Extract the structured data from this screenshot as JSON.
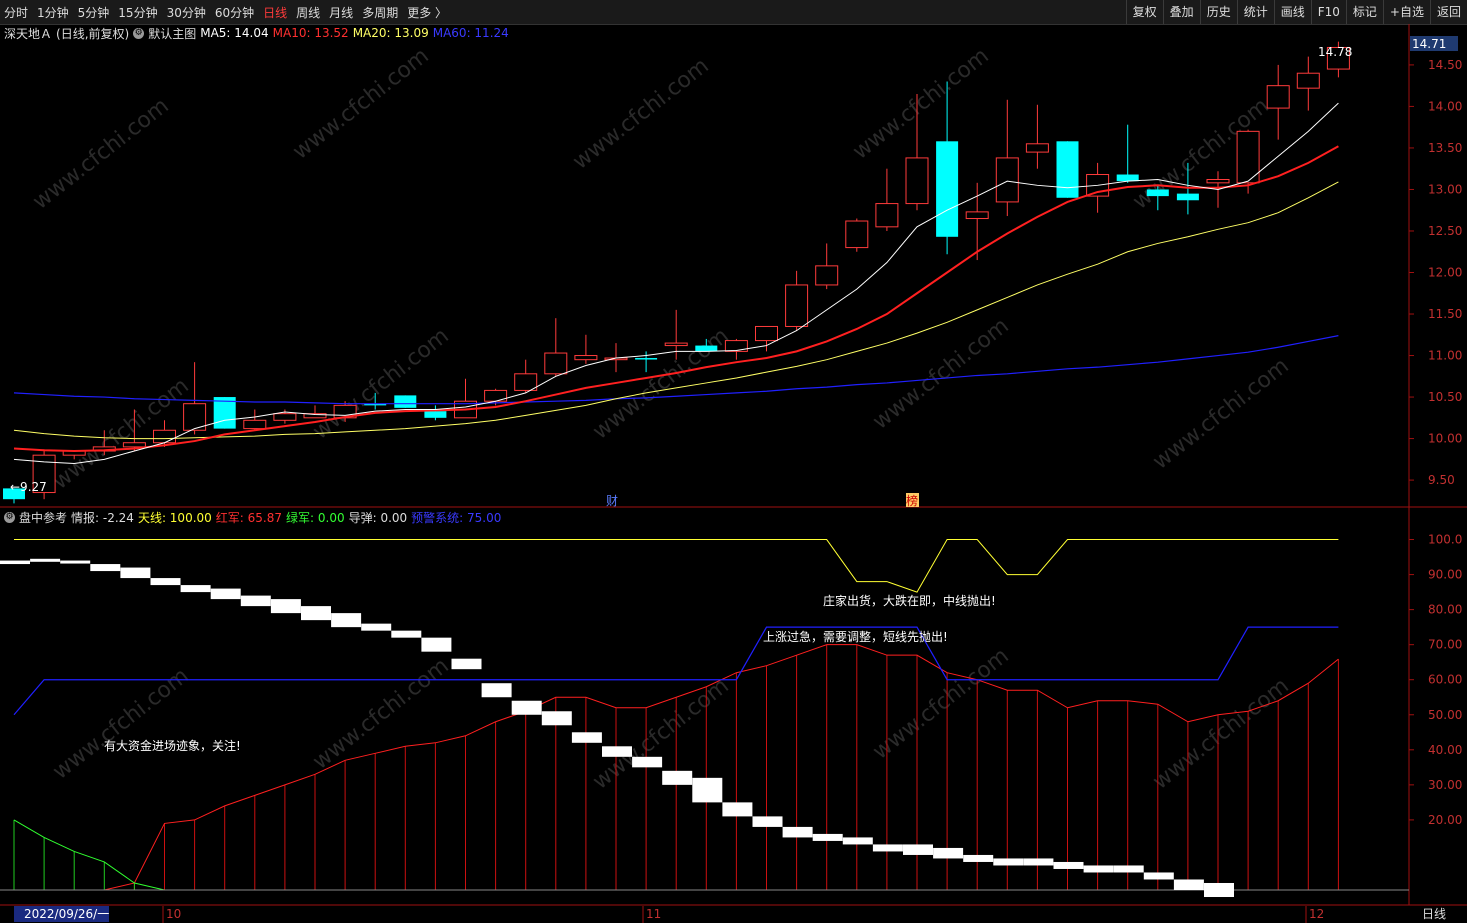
{
  "toolbar": {
    "periods": [
      "分时",
      "1分钟",
      "5分钟",
      "15分钟",
      "30分钟",
      "60分钟",
      "日线",
      "周线",
      "月线",
      "多周期",
      "更多 〉"
    ],
    "active_period": "日线",
    "actions": [
      "复权",
      "叠加",
      "历史",
      "统计",
      "画线",
      "F10",
      "标记",
      "+自选",
      "返回"
    ]
  },
  "main": {
    "stock_name": "深天地Ａ",
    "chart_mode": "(日线,前复权)",
    "template": "默认主图",
    "ma5": "MA5: 14.04",
    "ma10": "MA10: 13.52",
    "ma20": "MA20: 13.09",
    "ma60": "MA60: 11.24",
    "current_price_tag": "14.71",
    "high_label": "14.78",
    "low_label": "←9.27",
    "event_fin": "财",
    "event_bang": "榜",
    "y_ticks": [
      "14.50",
      "14.00",
      "13.50",
      "13.00",
      "12.50",
      "12.00",
      "11.50",
      "11.00",
      "10.50",
      "10.00",
      "9.50"
    ]
  },
  "indicator": {
    "name": "盘中参考",
    "qingbao": "情报: -2.24",
    "tianxian": "天线: 100.00",
    "hongjun": "红军: 65.87",
    "lvjun": "绿军: 0.00",
    "daodan": "导弹: 0.00",
    "alert": "预警系统: 75.00",
    "notes": [
      "庄家出货，大跌在即，中线抛出!",
      "上涨过急，需要调整，短线先抛出!",
      "有大资金进场迹象，关注!"
    ],
    "y_ticks": [
      "100.0",
      "90.00",
      "80.00",
      "70.00",
      "60.00",
      "50.00",
      "40.00",
      "30.00",
      "20.00"
    ]
  },
  "xaxis": {
    "date_label": "2022/09/26/一",
    "months": [
      "10",
      "11",
      "12"
    ],
    "period_label": "日线"
  },
  "watermark": "www.cfchi.com",
  "colors": {
    "up": "#ff3b3b",
    "down": "#00ffff",
    "ma5": "#ffffff",
    "ma10": "#ff2020",
    "ma20": "#ffff66",
    "ma60": "#2020ff"
  },
  "chart_data": {
    "type": "candlestick",
    "ylim": [
      9.2,
      14.8
    ],
    "candles": [
      [
        9.27,
        9.4,
        9.22,
        9.4,
        "down"
      ],
      [
        9.35,
        9.87,
        9.27,
        9.8,
        "up"
      ],
      [
        9.8,
        9.85,
        9.75,
        9.85,
        "up"
      ],
      [
        9.85,
        10.1,
        9.8,
        9.9,
        "up"
      ],
      [
        9.9,
        10.35,
        9.85,
        9.95,
        "up"
      ],
      [
        9.95,
        10.22,
        9.9,
        10.1,
        "up"
      ],
      [
        10.1,
        10.92,
        10.05,
        10.42,
        "up"
      ],
      [
        10.5,
        10.5,
        10.12,
        10.12,
        "down"
      ],
      [
        10.12,
        10.35,
        10.1,
        10.22,
        "up"
      ],
      [
        10.22,
        10.35,
        10.18,
        10.3,
        "up"
      ],
      [
        10.3,
        10.4,
        10.25,
        10.25,
        "up"
      ],
      [
        10.25,
        10.45,
        10.2,
        10.4,
        "up"
      ],
      [
        10.4,
        10.55,
        10.35,
        10.42,
        "down"
      ],
      [
        10.52,
        10.52,
        10.37,
        10.37,
        "down"
      ],
      [
        10.33,
        10.4,
        10.22,
        10.25,
        "down"
      ],
      [
        10.25,
        10.72,
        10.25,
        10.45,
        "up"
      ],
      [
        10.45,
        10.6,
        10.4,
        10.58,
        "up"
      ],
      [
        10.58,
        10.95,
        10.55,
        10.78,
        "up"
      ],
      [
        10.78,
        11.45,
        10.75,
        11.03,
        "up"
      ],
      [
        10.95,
        11.25,
        10.9,
        11.0,
        "up"
      ],
      [
        10.95,
        11.15,
        10.8,
        10.97,
        "up"
      ],
      [
        10.97,
        11.05,
        10.8,
        10.97,
        "down"
      ],
      [
        11.12,
        11.55,
        10.95,
        11.15,
        "up"
      ],
      [
        11.12,
        11.2,
        11.05,
        11.05,
        "down"
      ],
      [
        11.05,
        11.2,
        10.95,
        11.18,
        "up"
      ],
      [
        11.18,
        11.35,
        11.05,
        11.35,
        "up"
      ],
      [
        11.35,
        12.02,
        11.3,
        11.85,
        "up"
      ],
      [
        11.85,
        12.35,
        11.8,
        12.08,
        "up"
      ],
      [
        12.3,
        12.65,
        12.25,
        12.62,
        "up"
      ],
      [
        12.55,
        13.25,
        12.5,
        12.83,
        "up"
      ],
      [
        12.83,
        14.15,
        12.75,
        13.38,
        "up"
      ],
      [
        13.58,
        14.3,
        12.22,
        12.43,
        "down"
      ],
      [
        12.65,
        13.08,
        12.15,
        12.73,
        "up"
      ],
      [
        12.85,
        14.08,
        12.68,
        13.38,
        "up"
      ],
      [
        13.45,
        14.02,
        13.25,
        13.55,
        "up"
      ],
      [
        13.58,
        13.58,
        12.9,
        12.9,
        "down"
      ],
      [
        12.92,
        13.32,
        12.72,
        13.18,
        "up"
      ],
      [
        13.18,
        13.78,
        13.08,
        13.1,
        "down"
      ],
      [
        13.0,
        13.05,
        12.75,
        12.92,
        "down"
      ],
      [
        12.95,
        13.32,
        12.7,
        12.87,
        "down"
      ],
      [
        13.08,
        13.22,
        12.78,
        13.12,
        "up"
      ],
      [
        13.08,
        13.72,
        12.95,
        13.7,
        "up"
      ],
      [
        13.98,
        14.5,
        13.6,
        14.25,
        "up"
      ],
      [
        14.22,
        14.6,
        13.95,
        14.4,
        "up"
      ],
      [
        14.45,
        14.78,
        14.35,
        14.71,
        "up"
      ]
    ],
    "ma5": [
      9.75,
      9.72,
      9.7,
      9.75,
      9.85,
      9.95,
      10.12,
      10.22,
      10.26,
      10.32,
      10.29,
      10.28,
      10.33,
      10.35,
      10.35,
      10.38,
      10.45,
      10.55,
      10.75,
      10.88,
      10.97,
      11.0,
      11.05,
      11.05,
      11.06,
      11.12,
      11.3,
      11.55,
      11.8,
      12.12,
      12.55,
      12.75,
      12.92,
      13.1,
      13.05,
      13.02,
      13.05,
      13.1,
      13.12,
      13.05,
      13.0,
      13.1,
      13.4,
      13.7,
      14.04
    ],
    "ma10": [
      9.88,
      9.86,
      9.85,
      9.86,
      9.88,
      9.92,
      9.97,
      10.05,
      10.1,
      10.15,
      10.2,
      10.26,
      10.31,
      10.33,
      10.34,
      10.35,
      10.38,
      10.45,
      10.53,
      10.61,
      10.67,
      10.73,
      10.79,
      10.86,
      10.92,
      10.97,
      11.05,
      11.17,
      11.32,
      11.5,
      11.75,
      12.0,
      12.25,
      12.47,
      12.67,
      12.85,
      12.97,
      13.03,
      13.05,
      13.02,
      13.02,
      13.05,
      13.16,
      13.32,
      13.52
    ],
    "ma20": [
      10.1,
      10.06,
      10.03,
      10.01,
      10.0,
      10.0,
      10.01,
      10.02,
      10.03,
      10.05,
      10.06,
      10.08,
      10.1,
      10.12,
      10.15,
      10.18,
      10.22,
      10.28,
      10.34,
      10.4,
      10.48,
      10.55,
      10.61,
      10.67,
      10.73,
      10.8,
      10.87,
      10.95,
      11.05,
      11.15,
      11.27,
      11.4,
      11.55,
      11.7,
      11.85,
      11.98,
      12.1,
      12.25,
      12.35,
      12.43,
      12.52,
      12.6,
      12.72,
      12.9,
      13.09
    ],
    "ma60": [
      10.55,
      10.53,
      10.51,
      10.5,
      10.48,
      10.47,
      10.46,
      10.45,
      10.44,
      10.44,
      10.43,
      10.42,
      10.42,
      10.42,
      10.42,
      10.42,
      10.43,
      10.44,
      10.45,
      10.46,
      10.48,
      10.49,
      10.51,
      10.53,
      10.55,
      10.57,
      10.6,
      10.62,
      10.65,
      10.67,
      10.7,
      10.73,
      10.76,
      10.78,
      10.81,
      10.84,
      10.86,
      10.89,
      10.92,
      10.96,
      11.0,
      11.04,
      11.1,
      11.17,
      11.24
    ],
    "ind_ylim": [
      0,
      105
    ],
    "tianxian": [
      100,
      100,
      100,
      100,
      100,
      100,
      100,
      100,
      100,
      100,
      100,
      100,
      100,
      100,
      100,
      100,
      100,
      100,
      100,
      100,
      100,
      100,
      100,
      100,
      100,
      100,
      100,
      100,
      88,
      88,
      85,
      100,
      100,
      90,
      90,
      100,
      100,
      100,
      100,
      100,
      100,
      100,
      100,
      100,
      100
    ],
    "alert_line": [
      50,
      60,
      60,
      60,
      60,
      60,
      60,
      60,
      60,
      60,
      60,
      60,
      60,
      60,
      60,
      60,
      60,
      60,
      60,
      60,
      60,
      60,
      60,
      60,
      60,
      75,
      75,
      75,
      75,
      75,
      75,
      60,
      60,
      60,
      60,
      60,
      60,
      60,
      60,
      60,
      60,
      75,
      75,
      75,
      75
    ],
    "hongjun": [
      0,
      0,
      0,
      0,
      2,
      19,
      20,
      24,
      27,
      30,
      33,
      37,
      39,
      41,
      42,
      44,
      48,
      51,
      55,
      55,
      52,
      52,
      55,
      58,
      62,
      64,
      67,
      70,
      70,
      67,
      67,
      62,
      60,
      57,
      57,
      52,
      54,
      54,
      53,
      48,
      50,
      51,
      54,
      59,
      65.87
    ],
    "lvjun": [
      20,
      15,
      11,
      8,
      2,
      0,
      0,
      0,
      0,
      0,
      0,
      0,
      0,
      0,
      0,
      0,
      0,
      0,
      0,
      0,
      0,
      0,
      0,
      0,
      0,
      0,
      0,
      0,
      0,
      0,
      0,
      0,
      0,
      0,
      0,
      0,
      0,
      0,
      0,
      0,
      0,
      0,
      0,
      0,
      0
    ],
    "qingbao_bars": [
      [
        93,
        94
      ],
      [
        94,
        94.5
      ],
      [
        93.5,
        94
      ],
      [
        91,
        93
      ],
      [
        89,
        92
      ],
      [
        87,
        89
      ],
      [
        85,
        87
      ],
      [
        83,
        86
      ],
      [
        81,
        84
      ],
      [
        79,
        83
      ],
      [
        77,
        81
      ],
      [
        75,
        79
      ],
      [
        74,
        76
      ],
      [
        72,
        74
      ],
      [
        68,
        72
      ],
      [
        63,
        66
      ],
      [
        55,
        59
      ],
      [
        50,
        54
      ],
      [
        47,
        51
      ],
      [
        42,
        45
      ],
      [
        38,
        41
      ],
      [
        35,
        38
      ],
      [
        30,
        34
      ],
      [
        25,
        32
      ],
      [
        21,
        25
      ],
      [
        18,
        21
      ],
      [
        15,
        18
      ],
      [
        14,
        16
      ],
      [
        13,
        15
      ],
      [
        11,
        13
      ],
      [
        10,
        13
      ],
      [
        9,
        12
      ],
      [
        8,
        10
      ],
      [
        7,
        9
      ],
      [
        7,
        9
      ],
      [
        6,
        8
      ],
      [
        5,
        7
      ],
      [
        5,
        7
      ],
      [
        3,
        5
      ],
      [
        0,
        3
      ],
      [
        -2,
        2
      ]
    ]
  }
}
